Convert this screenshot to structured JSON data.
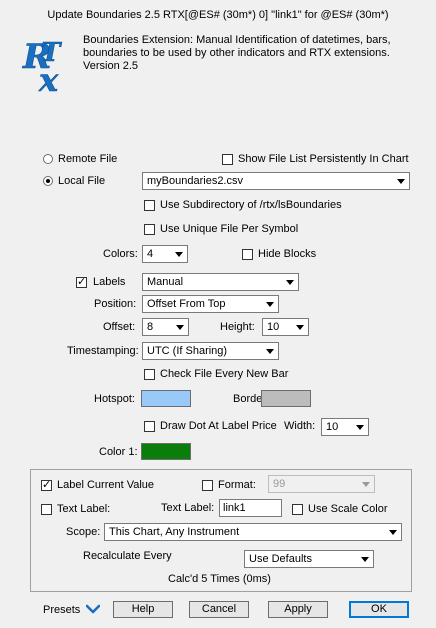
{
  "window": {
    "title": "Update Boundaries 2.5 RTX[@ES# (30m*) 0] \"link1\" for @ES# (30m*)"
  },
  "header": {
    "logo_text": "RTX",
    "description": "Boundaries Extension: Manual Identification of datetimes, bars, boundaries to be used by other indicators and RTX extensions. Version 2.5"
  },
  "file": {
    "remote_label": "Remote File",
    "local_label": "Local File",
    "remote_selected": false,
    "local_selected": true,
    "show_list_label": "Show File List Persistently In Chart",
    "show_list_checked": false,
    "filename": "myBoundaries2.csv",
    "use_subdir_label": "Use Subdirectory of /rtx/lsBoundaries",
    "use_subdir_checked": false,
    "unique_file_label": "Use Unique File Per Symbol",
    "unique_file_checked": false
  },
  "colors": {
    "label": "Colors:",
    "value": "4",
    "hide_blocks_label": "Hide Blocks",
    "hide_blocks_checked": false
  },
  "labels": {
    "label": "Labels",
    "checked": true,
    "mode": "Manual",
    "position_label": "Position:",
    "position": "Offset From Top",
    "offset_label": "Offset:",
    "offset": "8",
    "height_label": "Height:",
    "height": "10",
    "timestamping_label": "Timestamping:",
    "timestamping": "UTC (If Sharing)",
    "check_file_label": "Check File Every New Bar",
    "check_file_checked": false,
    "hotspot_label": "Hotspot:",
    "hotspot_color": "#99c9f8",
    "border_label": "Border:",
    "border_color": "#bcbcbc",
    "draw_dot_label": "Draw Dot At Label Price",
    "draw_dot_checked": false,
    "width_label": "Width:",
    "width": "10",
    "color1_label": "Color 1:",
    "color1": "#0b7d0b"
  },
  "group": {
    "label_current_value_label": "Label Current Value",
    "label_current_value_checked": true,
    "format_label": "Format:",
    "format_checked": false,
    "format_value": "99",
    "text_label_check_label": "Text Label:",
    "text_label_checked": false,
    "text_label_field_label": "Text Label:",
    "text_label_value": "link1",
    "use_scale_color_label": "Use Scale Color",
    "use_scale_color_checked": false,
    "scope_label": "Scope:",
    "scope_value": "This Chart, Any Instrument",
    "recalculate_label": "Recalculate Every",
    "recalculate_value": "Use Defaults",
    "calcd_text": "Calc'd 5 Times (0ms)"
  },
  "footer": {
    "presets_label": "Presets",
    "help_label": "Help",
    "cancel_label": "Cancel",
    "apply_label": "Apply",
    "ok_label": "OK"
  }
}
